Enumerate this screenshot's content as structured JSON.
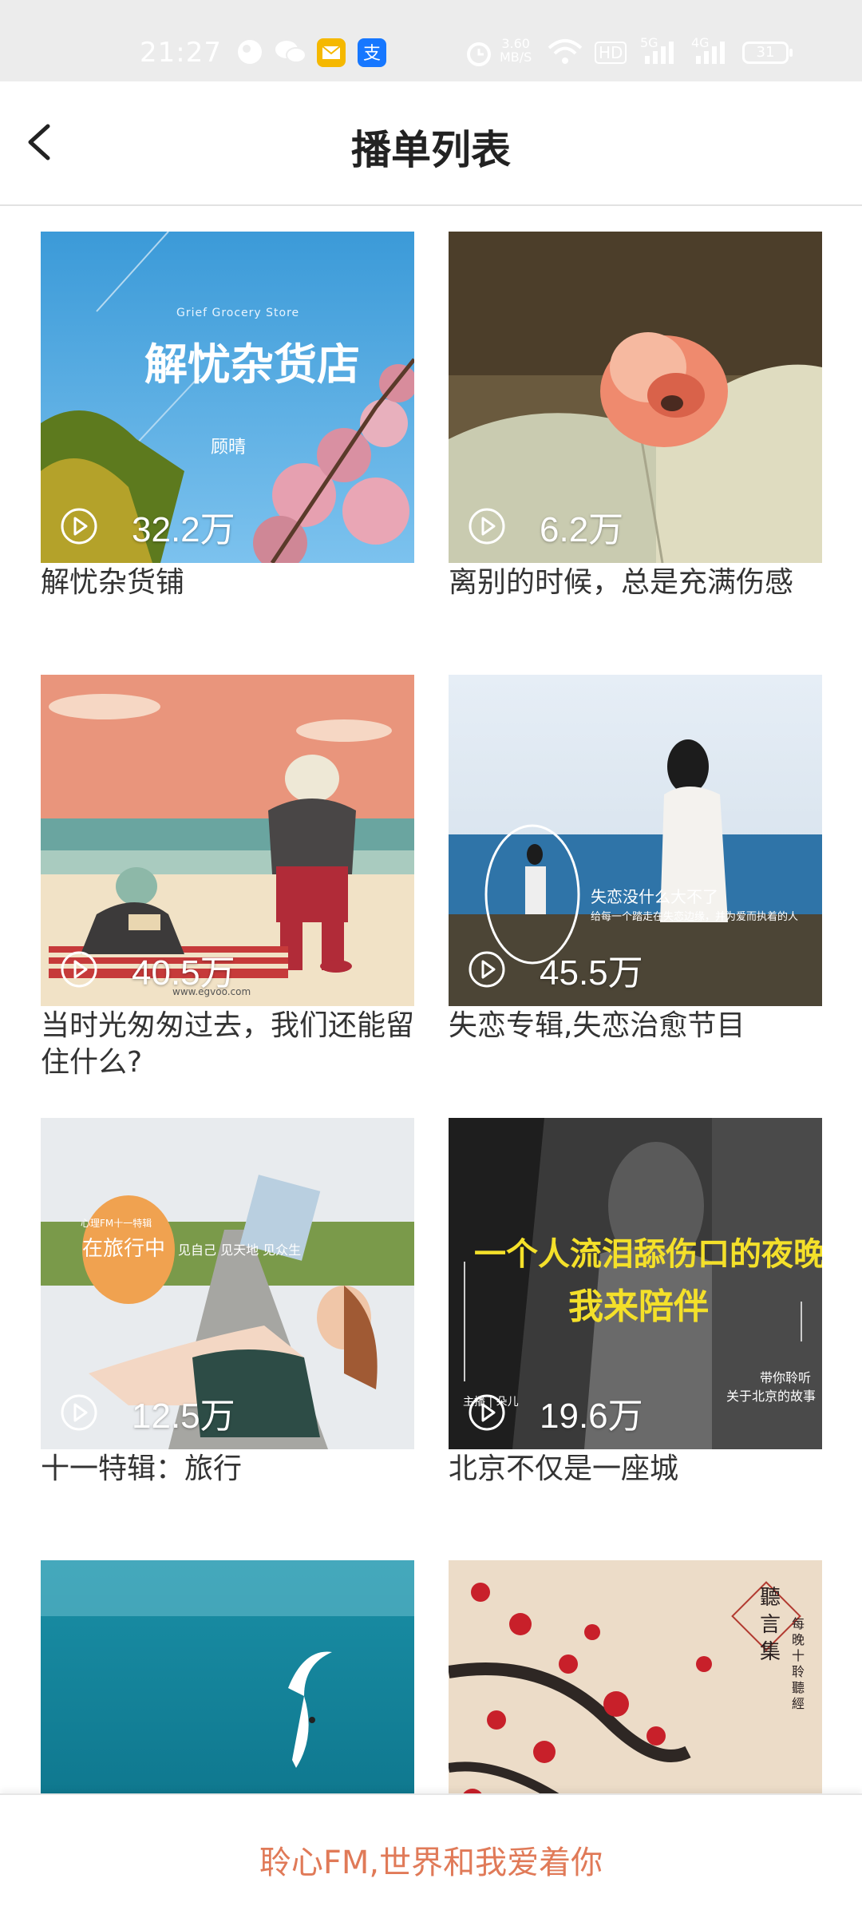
{
  "status_bar": {
    "time": "21:27",
    "network_speed_value": "3.60",
    "network_speed_unit": "MB/S",
    "battery": "31",
    "hd_label": "HD",
    "signal_1": "5G",
    "signal_2": "4G"
  },
  "header": {
    "title": "播单列表"
  },
  "playlists": [
    {
      "title": "解忧杂货铺",
      "plays": "32.2万",
      "cover_text": "解忧杂货店",
      "cover_sub": "Grief Grocery Store",
      "cover_author": "顾晴"
    },
    {
      "title": "离别的时候，总是充满伤感",
      "plays": "6.2万"
    },
    {
      "title": "当时光匆匆过去，我们还能留住什么?",
      "plays": "40.5万",
      "cover_url_text": "www.egvoo.com"
    },
    {
      "title": "失恋专辑,失恋治愈节目",
      "plays": "45.5万",
      "cover_text": "失恋没什么大不了",
      "cover_sub": "给每一个踏走在失恋边缘，并为爱而执着的人"
    },
    {
      "title": "十一特辑：旅行",
      "plays": "12.5万",
      "cover_badge_top": "心理FM十一特辑",
      "cover_badge": "在旅行中",
      "cover_sub": "见自己 见天地 见众生"
    },
    {
      "title": "北京不仅是一座城",
      "plays": "19.6万",
      "cover_text_line1": "一个人流泪舔伤口的夜晚",
      "cover_text_line2": "我来陪伴",
      "cover_caption_1": "带你聆听",
      "cover_caption_2": "关于北京的故事",
      "cover_host": "主播 | 朵儿"
    },
    {
      "title": "",
      "plays": ""
    },
    {
      "title": "",
      "plays": "",
      "cover_text": "聽言集",
      "cover_sub": "每晚十 聆聽經"
    }
  ],
  "footer": {
    "slogan": "聆心FM,世界和我爱着你"
  },
  "colors": {
    "accent": "#e07a58",
    "status_bar_bg": "#ececec"
  }
}
